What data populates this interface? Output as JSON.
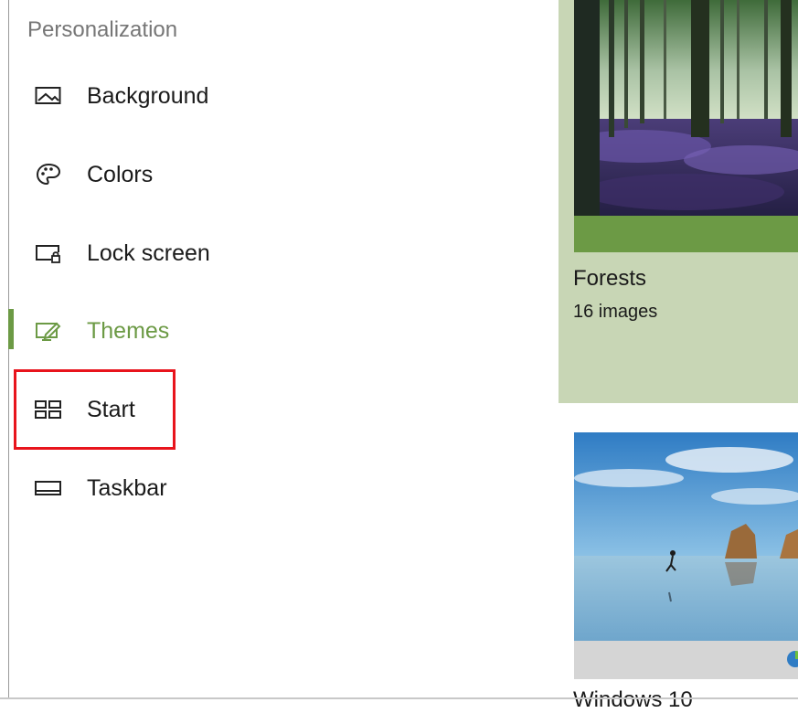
{
  "section_title": "Personalization",
  "nav": [
    {
      "label": "Background",
      "icon": "picture-icon"
    },
    {
      "label": "Colors",
      "icon": "palette-icon"
    },
    {
      "label": "Lock screen",
      "icon": "lock-screen-icon"
    },
    {
      "label": "Themes",
      "icon": "themes-icon",
      "active": true
    },
    {
      "label": "Start",
      "icon": "start-icon",
      "highlighted": true
    },
    {
      "label": "Taskbar",
      "icon": "taskbar-icon"
    }
  ],
  "themes": [
    {
      "name": "Forests",
      "count": "16 images"
    },
    {
      "name": "Windows 10"
    }
  ],
  "colors": {
    "accent": "#6c9a45",
    "highlight_border": "#e8141c",
    "forest_card_bg": "#c8d6b5"
  }
}
